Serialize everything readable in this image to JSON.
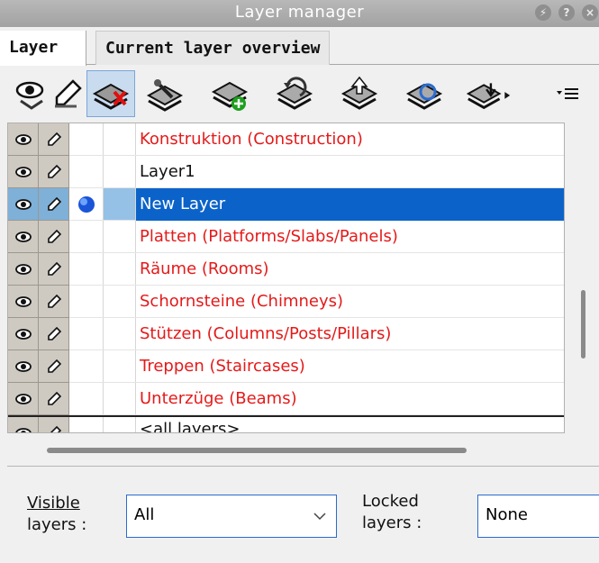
{
  "window": {
    "title": "Layer manager",
    "buttons": [
      "⚡",
      "?",
      "×"
    ]
  },
  "tabs": [
    {
      "label": "Layer",
      "active": true
    },
    {
      "label": "Current layer overview",
      "active": false
    }
  ],
  "toolbar": {
    "buttons": [
      {
        "icon": "eye-icon"
      },
      {
        "icon": "pencil-icon"
      },
      {
        "icon": "delete-layer-icon",
        "pressed": true
      },
      {
        "icon": "layer-settings-icon"
      },
      {
        "icon": "new-layer-icon"
      },
      {
        "icon": "undo-layer-icon"
      },
      {
        "icon": "layer-up-icon"
      },
      {
        "icon": "refresh-layer-icon"
      },
      {
        "icon": "layer-down-icon"
      },
      {
        "icon": "menu-icon"
      }
    ]
  },
  "layers": {
    "rows": [
      {
        "name": "Konstruktion (Construction)",
        "color": "#e41a1a"
      },
      {
        "name": "Layer1",
        "color": "#111111"
      },
      {
        "name": "New Layer",
        "color": "#ffffff",
        "selected": true,
        "current": true
      },
      {
        "name": "Platten (Platforms/Slabs/Panels)",
        "color": "#e41a1a"
      },
      {
        "name": "Räume (Rooms)",
        "color": "#e41a1a"
      },
      {
        "name": "Schornsteine (Chimneys)",
        "color": "#e41a1a"
      },
      {
        "name": "Stützen (Columns/Posts/Pillars)",
        "color": "#e41a1a"
      },
      {
        "name": "Treppen (Staircases)",
        "color": "#e41a1a"
      },
      {
        "name": "Unterzüge (Beams)",
        "color": "#e41a1a"
      }
    ],
    "footer_row": "<all layers>"
  },
  "filters": {
    "visible_label_1": "Visible",
    "visible_label_2": "layers :",
    "visible_value": "All",
    "locked_label_1": "Locked",
    "locked_label_2": "layers :",
    "locked_value": "None"
  }
}
